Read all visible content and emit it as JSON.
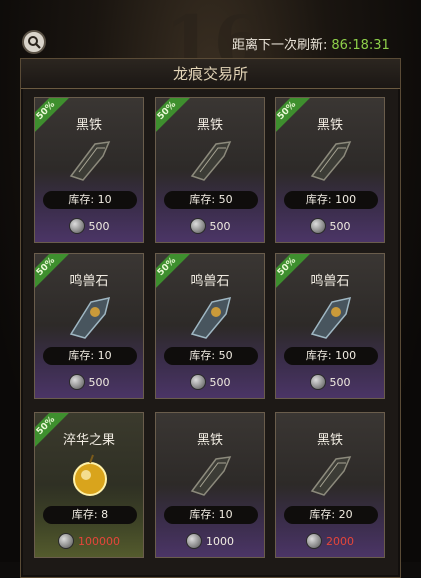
{
  "header": {
    "refresh_label": "距离下一次刷新:",
    "refresh_time": "86:18:31",
    "bg_number": "16"
  },
  "panel": {
    "title": "龙痕交易所"
  },
  "items": [
    {
      "name": "黑铁",
      "discount": "50%",
      "stock": "库存: 10",
      "price": "500",
      "kind": "iron",
      "price_color": "normal"
    },
    {
      "name": "黑铁",
      "discount": "50%",
      "stock": "库存: 50",
      "price": "500",
      "kind": "iron",
      "price_color": "normal"
    },
    {
      "name": "黑铁",
      "discount": "50%",
      "stock": "库存: 100",
      "price": "500",
      "kind": "iron",
      "price_color": "normal"
    },
    {
      "name": "鸣兽石",
      "discount": "50%",
      "stock": "库存: 10",
      "price": "500",
      "kind": "stone",
      "price_color": "normal"
    },
    {
      "name": "鸣兽石",
      "discount": "50%",
      "stock": "库存: 50",
      "price": "500",
      "kind": "stone",
      "price_color": "normal"
    },
    {
      "name": "鸣兽石",
      "discount": "50%",
      "stock": "库存: 100",
      "price": "500",
      "kind": "stone",
      "price_color": "normal"
    },
    {
      "name": "淬华之果",
      "discount": "50%",
      "stock": "库存: 8",
      "price": "100000",
      "kind": "fruit",
      "price_color": "red"
    },
    {
      "name": "黑铁",
      "discount": "",
      "stock": "库存: 10",
      "price": "1000",
      "kind": "iron",
      "price_color": "normal"
    },
    {
      "name": "黑铁",
      "discount": "",
      "stock": "库存: 20",
      "price": "2000",
      "kind": "iron",
      "price_color": "red"
    }
  ],
  "colors": {
    "refresh_time": "#8ed04a",
    "price_red": "#e5463a",
    "discount_green": "#3e8f2e"
  }
}
